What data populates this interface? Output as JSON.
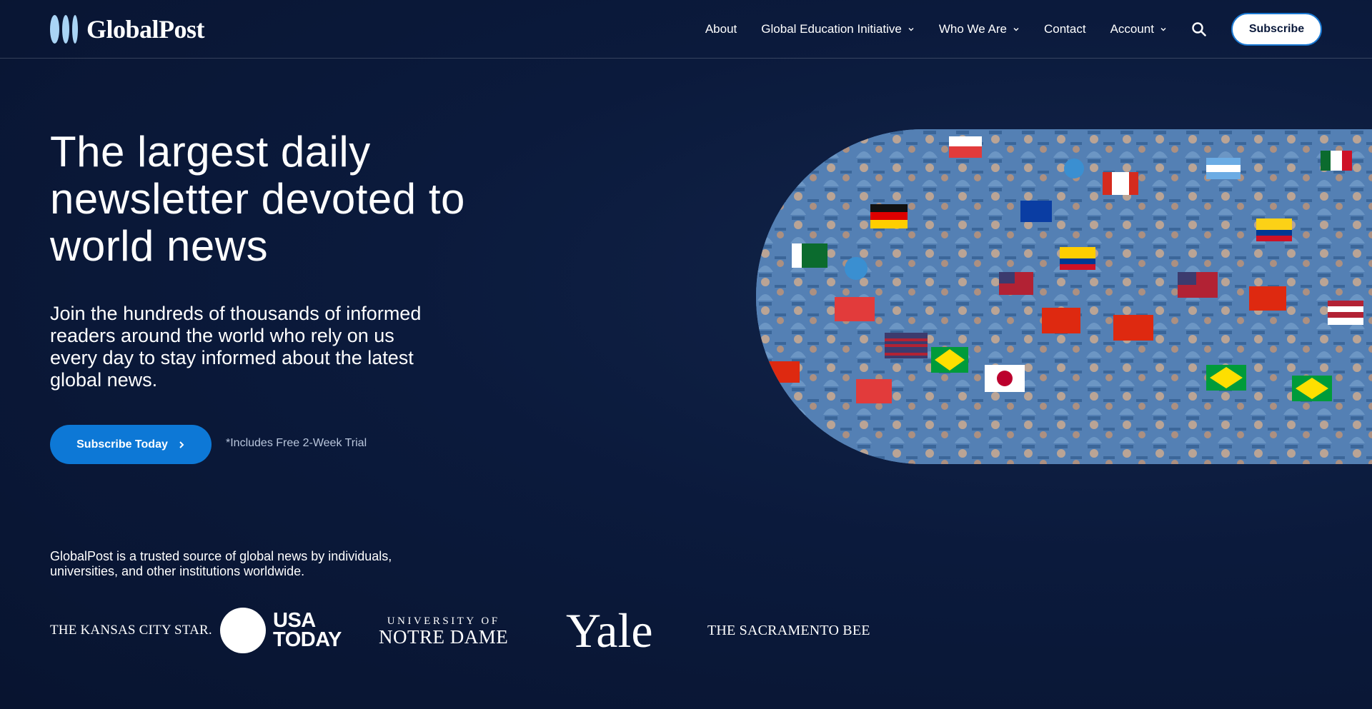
{
  "brand": {
    "name": "GlobalPost",
    "logo_color": "#a9d4f5"
  },
  "nav": {
    "items": [
      {
        "label": "About",
        "dropdown": false
      },
      {
        "label": "Global Education Initiative",
        "dropdown": true
      },
      {
        "label": "Who We Are",
        "dropdown": true
      },
      {
        "label": "Contact",
        "dropdown": false
      },
      {
        "label": "Account",
        "dropdown": true
      }
    ],
    "search_icon": "search-icon",
    "subscribe_label": "Subscribe"
  },
  "hero": {
    "title": "The largest daily newsletter devoted to world news",
    "subtitle": "Join the hundreds of thousands of informed readers around the world who rely on us every day to stay informed about the latest global news.",
    "cta_label": "Subscribe Today",
    "cta_icon": "chevron-right-icon",
    "trial_note": "*Includes Free 2-Week Trial",
    "accent_color": "#0d78d6"
  },
  "trust": {
    "text": "GlobalPost is a trusted source of global news by individuals, universities, and other institutions worldwide.",
    "logos": {
      "kansas_city_star": "THE KANSAS CITY STAR.",
      "usa_today_line1": "USA",
      "usa_today_line2": "TODAY",
      "notre_dame_line1": "UNIVERSITY OF",
      "notre_dame_line2": "NOTRE DAME",
      "yale": "Yale",
      "sacramento_bee": "THE SACRAMENTO BEE"
    }
  },
  "colors": {
    "background": "#0b1a3c",
    "text": "#ffffff",
    "muted": "#b9c6dc"
  }
}
